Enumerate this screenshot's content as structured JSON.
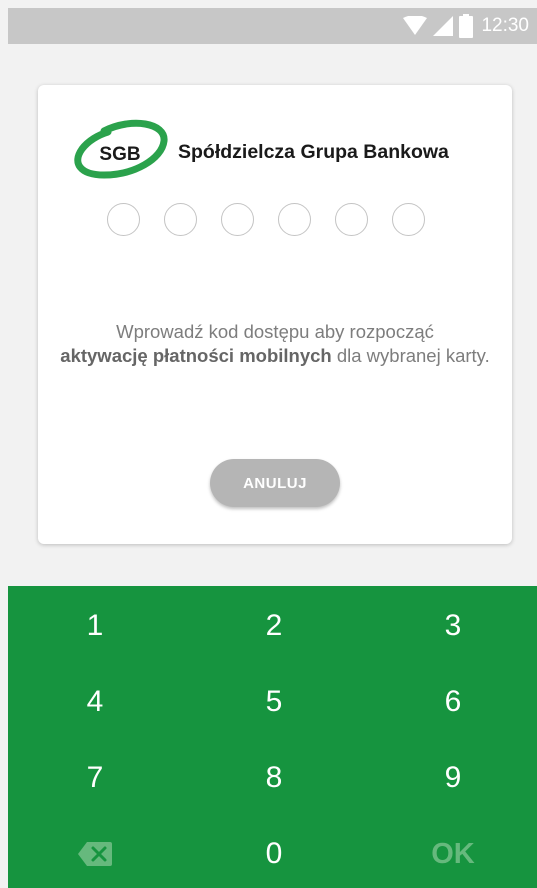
{
  "status_bar": {
    "time": "12:30",
    "icons": [
      "wifi-icon",
      "signal-icon",
      "battery-icon"
    ]
  },
  "brand": {
    "logo_text": "SGB",
    "name": "Spółdzielcza Grupa Bankowa",
    "color": "#2ba24c"
  },
  "pin": {
    "length": 6,
    "filled": 0
  },
  "message": {
    "before": "Wprowadź kod dostępu aby rozpocząć",
    "bold": "aktywację płatności mobilnych",
    "after": "dla wybranej karty."
  },
  "buttons": {
    "cancel": "ANULUJ"
  },
  "keypad": {
    "keys": [
      "1",
      "2",
      "3",
      "4",
      "5",
      "6",
      "7",
      "8",
      "9",
      "",
      "0",
      "OK"
    ],
    "backspace_icon": "backspace-icon",
    "background": "#16943f"
  }
}
